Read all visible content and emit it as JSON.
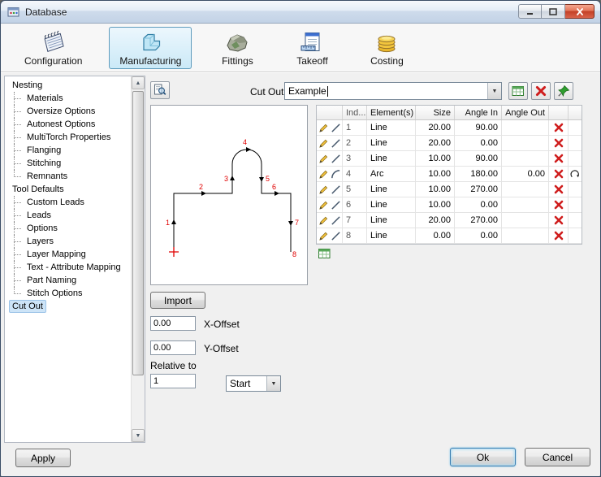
{
  "window": {
    "title": "Database"
  },
  "titlebar": {
    "buttons": [
      "minimize",
      "maximize",
      "close"
    ]
  },
  "toolbar": {
    "tabs": [
      {
        "label": "Configuration",
        "icon": "configuration-icon",
        "selected": false
      },
      {
        "label": "Manufacturing",
        "icon": "manufacturing-icon",
        "selected": true
      },
      {
        "label": "Fittings",
        "icon": "fittings-icon",
        "selected": false
      },
      {
        "label": "Takeoff",
        "icon": "takeoff-icon",
        "selected": false
      },
      {
        "label": "Costing",
        "icon": "costing-icon",
        "selected": false
      }
    ]
  },
  "sidebar": {
    "apply_label": "Apply",
    "items": [
      {
        "label": "Nesting",
        "level": 0,
        "selected": false
      },
      {
        "label": "Materials",
        "level": 1,
        "selected": false
      },
      {
        "label": "Oversize Options",
        "level": 1,
        "selected": false
      },
      {
        "label": "Autonest Options",
        "level": 1,
        "selected": false
      },
      {
        "label": "MultiTorch Properties",
        "level": 1,
        "selected": false
      },
      {
        "label": "Flanging",
        "level": 1,
        "selected": false
      },
      {
        "label": "Stitching",
        "level": 1,
        "selected": false
      },
      {
        "label": "Remnants",
        "level": 1,
        "selected": false
      },
      {
        "label": "Tool Defaults",
        "level": 0,
        "selected": false
      },
      {
        "label": "Custom Leads",
        "level": 1,
        "selected": false
      },
      {
        "label": "Leads",
        "level": 1,
        "selected": false
      },
      {
        "label": "Options",
        "level": 1,
        "selected": false
      },
      {
        "label": "Layers",
        "level": 1,
        "selected": false
      },
      {
        "label": "Layer Mapping",
        "level": 1,
        "selected": false
      },
      {
        "label": "Text - Attribute Mapping",
        "level": 1,
        "selected": false
      },
      {
        "label": "Part Naming",
        "level": 1,
        "selected": false
      },
      {
        "label": "Stitch Options",
        "level": 1,
        "selected": false
      },
      {
        "label": "Cut Out",
        "level": 0,
        "selected": true
      }
    ]
  },
  "cutout": {
    "label": "Cut Out",
    "selected_value": "Example",
    "import_label": "Import",
    "x_offset": {
      "value": "0.00",
      "label": "X-Offset"
    },
    "y_offset": {
      "value": "0.00",
      "label": "Y-Offset"
    },
    "relative_label": "Relative to",
    "relative_value": "1",
    "relative_mode": "Start",
    "preview_point_labels": [
      "1",
      "2",
      "3",
      "4",
      "5",
      "6",
      "7",
      "8"
    ]
  },
  "elements_table": {
    "headers": {
      "index": "Ind...",
      "element": "Element(s)",
      "size": "Size",
      "angle_in": "Angle In",
      "angle_out": "Angle Out"
    },
    "rows": [
      {
        "index": "1",
        "element": "Line",
        "size": "20.00",
        "angle_in": "90.00",
        "angle_out": ""
      },
      {
        "index": "2",
        "element": "Line",
        "size": "20.00",
        "angle_in": "0.00",
        "angle_out": ""
      },
      {
        "index": "3",
        "element": "Line",
        "size": "10.00",
        "angle_in": "90.00",
        "angle_out": ""
      },
      {
        "index": "4",
        "element": "Arc",
        "size": "10.00",
        "angle_in": "180.00",
        "angle_out": "0.00"
      },
      {
        "index": "5",
        "element": "Line",
        "size": "10.00",
        "angle_in": "270.00",
        "angle_out": ""
      },
      {
        "index": "6",
        "element": "Line",
        "size": "10.00",
        "angle_in": "0.00",
        "angle_out": ""
      },
      {
        "index": "7",
        "element": "Line",
        "size": "20.00",
        "angle_in": "270.00",
        "angle_out": ""
      },
      {
        "index": "8",
        "element": "Line",
        "size": "0.00",
        "angle_in": "0.00",
        "angle_out": ""
      }
    ]
  },
  "footer": {
    "ok_label": "Ok",
    "cancel_label": "Cancel"
  },
  "icons": {
    "scroll-up-icon": "▲",
    "scroll-down-icon": "▼",
    "combo-arrow-icon": "▼"
  },
  "colors": {
    "tab_selected_bg": "#cbe9f7",
    "tree_selection": "#cde4f7",
    "delete_red": "#cf1d1d",
    "accent_green": "#2f9e2f",
    "drawing_red": "#e00000"
  }
}
